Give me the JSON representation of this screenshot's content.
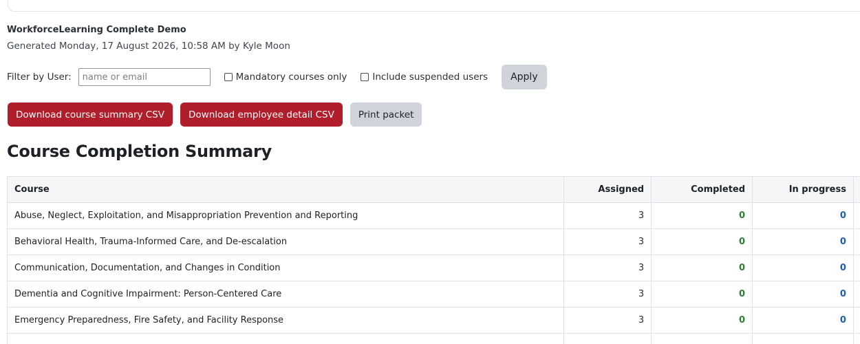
{
  "report": {
    "title": "WorkforceLearning Complete Demo",
    "meta": "Generated Monday, 17 August 2026, 10:58 AM by Kyle Moon"
  },
  "filter": {
    "label": "Filter by User:",
    "placeholder": "name or email",
    "value": "",
    "mandatory_label": "Mandatory courses only",
    "mandatory_checked": false,
    "suspended_label": "Include suspended users",
    "suspended_checked": false,
    "apply_label": "Apply"
  },
  "actions": {
    "download_summary": "Download course summary CSV",
    "download_detail": "Download employee detail CSV",
    "print_packet": "Print packet"
  },
  "colors": {
    "primary_button": "#b11e2b",
    "secondary_button": "#ced4da",
    "completed_value": "#2f7d32",
    "in_progress_value": "#1f5fb0"
  },
  "summary": {
    "heading": "Course Completion Summary",
    "columns": {
      "course": "Course",
      "assigned": "Assigned",
      "completed": "Completed",
      "in_progress": "In progress"
    },
    "rows": [
      {
        "course": "Abuse, Neglect, Exploitation, and Misappropriation Prevention and Reporting",
        "assigned": "3",
        "completed": "0",
        "in_progress": "0"
      },
      {
        "course": "Behavioral Health, Trauma-Informed Care, and De-escalation",
        "assigned": "3",
        "completed": "0",
        "in_progress": "0"
      },
      {
        "course": "Communication, Documentation, and Changes in Condition",
        "assigned": "3",
        "completed": "0",
        "in_progress": "0"
      },
      {
        "course": "Dementia and Cognitive Impairment: Person-Centered Care",
        "assigned": "3",
        "completed": "0",
        "in_progress": "0"
      },
      {
        "course": "Emergency Preparedness, Fire Safety, and Facility Response",
        "assigned": "3",
        "completed": "0",
        "in_progress": "0"
      }
    ]
  }
}
